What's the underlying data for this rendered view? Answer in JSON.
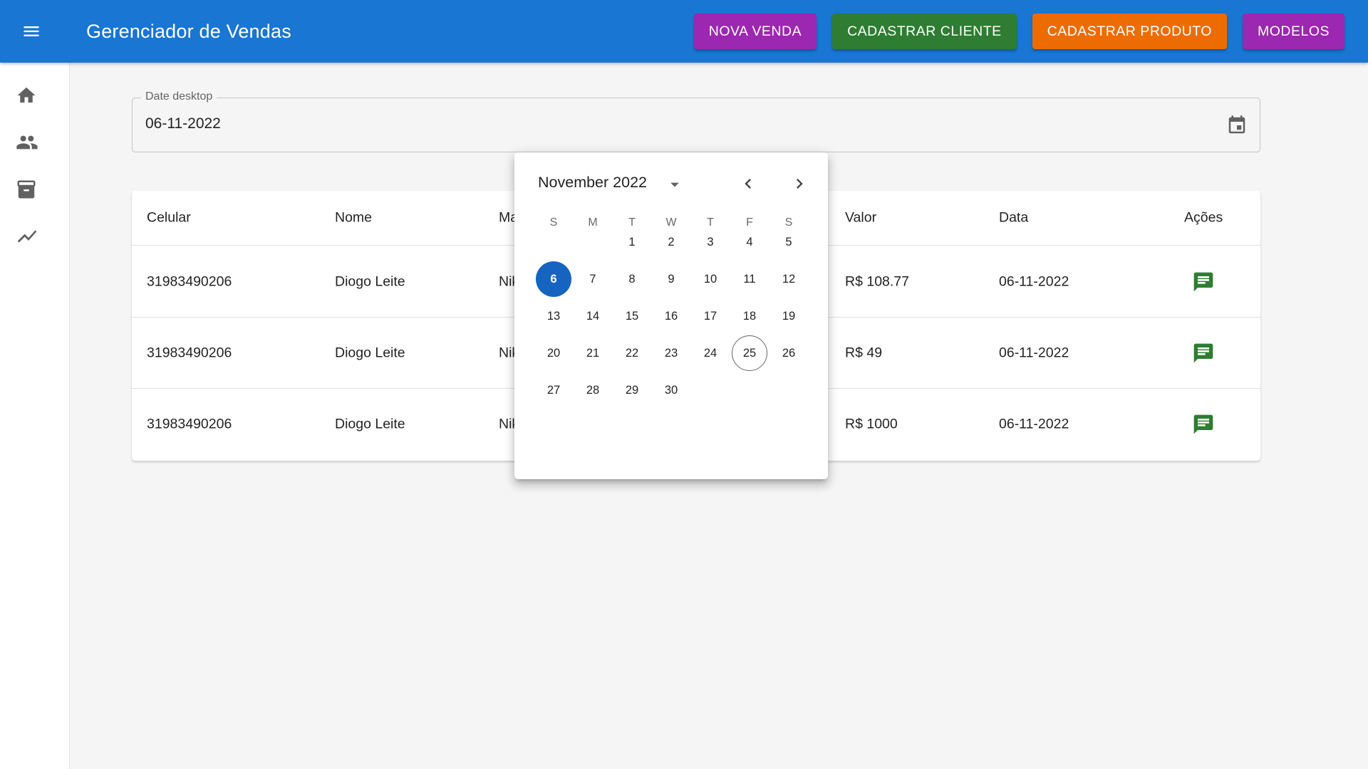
{
  "appbar": {
    "title": "Gerenciador de Vendas",
    "buttons": [
      {
        "label": "NOVA VENDA",
        "color": "#9c27b0"
      },
      {
        "label": "CADASTRAR CLIENTE",
        "color": "#2e7d32"
      },
      {
        "label": "CADASTRAR PRODUTO",
        "color": "#ed6c02"
      },
      {
        "label": "MODELOS",
        "color": "#9c27b0"
      }
    ]
  },
  "sidebar": {
    "icons": [
      "home-icon",
      "people-icon",
      "archive-icon",
      "trending-icon"
    ]
  },
  "date_field": {
    "label": "Date desktop",
    "value": "06-11-2022"
  },
  "table": {
    "headers": [
      "Celular",
      "Nome",
      "Ma",
      "Valor",
      "Data",
      "Ações"
    ],
    "rows": [
      {
        "celular": "31983490206",
        "nome": "Diogo Leite",
        "marca": "Nik",
        "valor": "R$ 108.77",
        "data": "06-11-2022"
      },
      {
        "celular": "31983490206",
        "nome": "Diogo Leite",
        "marca": "Nik",
        "valor": "R$ 49",
        "data": "06-11-2022"
      },
      {
        "celular": "31983490206",
        "nome": "Diogo Leite",
        "marca": "Nik",
        "valor": "R$ 1000",
        "data": "06-11-2022"
      }
    ],
    "action_icon": "chat-icon",
    "action_color": "#2e7d32"
  },
  "calendar": {
    "month_label": "November 2022",
    "weekdays": [
      "S",
      "M",
      "T",
      "W",
      "T",
      "F",
      "S"
    ],
    "weeks": [
      [
        "",
        "",
        "1",
        "2",
        "3",
        "4",
        "5"
      ],
      [
        "6",
        "7",
        "8",
        "9",
        "10",
        "11",
        "12"
      ],
      [
        "13",
        "14",
        "15",
        "16",
        "17",
        "18",
        "19"
      ],
      [
        "20",
        "21",
        "22",
        "23",
        "24",
        "25",
        "26"
      ],
      [
        "27",
        "28",
        "29",
        "30",
        "",
        "",
        ""
      ]
    ],
    "selected_day": "6",
    "today_day": "25",
    "accent": "#1565c0"
  }
}
